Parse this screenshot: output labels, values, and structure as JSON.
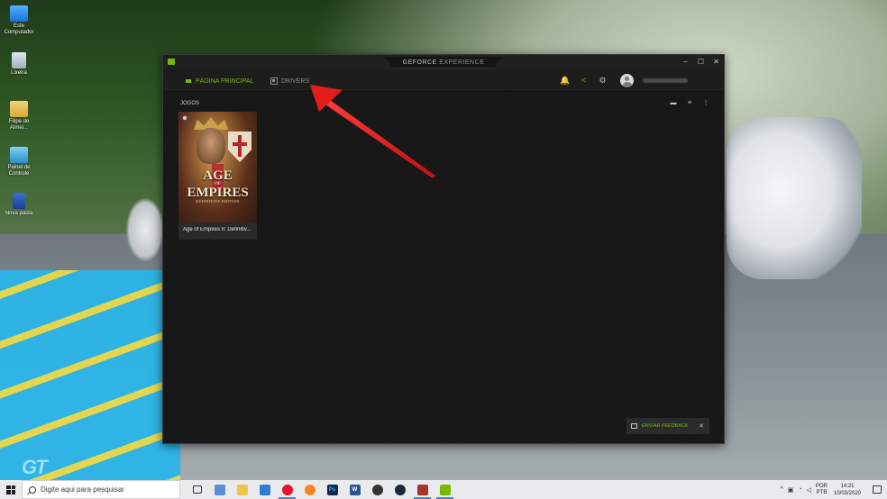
{
  "desktop": {
    "icons": [
      {
        "label": "Este Computador"
      },
      {
        "label": "Lixeira"
      },
      {
        "label": "Filipe de Almei..."
      },
      {
        "label": "Painel de Controle"
      },
      {
        "label": "Nova pasta"
      }
    ]
  },
  "app": {
    "title_part1": "GEFORCE",
    "title_part2": " EXPERIENCE",
    "window_buttons": {
      "minimize": "–",
      "maximize": "☐",
      "close": "✕"
    }
  },
  "nav": {
    "tabs": [
      {
        "label": "PÁGINA PRINCIPAL",
        "active": true
      },
      {
        "label": "DRIVERS",
        "active": false
      }
    ],
    "icons": {
      "notifications": "🔔",
      "share": "<",
      "settings": "⚙"
    }
  },
  "main": {
    "section_label": "JOGOS",
    "games": [
      {
        "title": "Age of Empires II: Definitiv..."
      }
    ],
    "cover": {
      "title_line1": "AGE",
      "title_of": "OF",
      "title_line2": "EMPIRES",
      "subtitle": "DEFINITIVE EDITION"
    }
  },
  "feedback": {
    "label": "ENVIAR FEEDBACK",
    "close": "✕"
  },
  "taskbar": {
    "search_placeholder": "Digite aqui para pesquisar",
    "lang_line1": "POR",
    "lang_line2": "PTB",
    "time": "14:21",
    "date": "10/03/2020"
  },
  "colors": {
    "accent": "#76b900",
    "arrow": "#e41c1c"
  }
}
